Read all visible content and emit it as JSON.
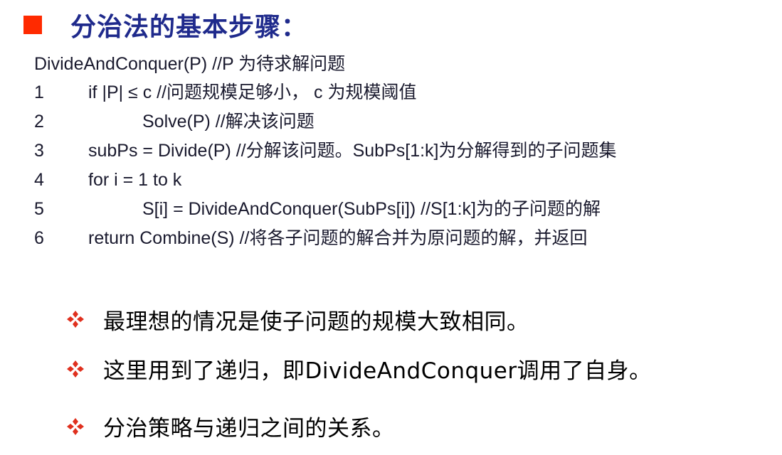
{
  "title": {
    "text": "分治法的基本步骤："
  },
  "code": {
    "header": "DivideAndConquer(P) //P 为待求解问题",
    "lines": [
      {
        "num": "1",
        "text": "if |P| ≤ c //问题规模足够小， c 为规模阈值"
      },
      {
        "num": "2",
        "text": "Solve(P) //解决该问题"
      },
      {
        "num": "3",
        "text": "subPs = Divide(P) //分解该问题。SubPs[1:k]为分解得到的子问题集"
      },
      {
        "num": "4",
        "text": "for i = 1 to k"
      },
      {
        "num": "5",
        "text": "S[i] = DivideAndConquer(SubPs[i]) //S[1:k]为的子问题的解"
      },
      {
        "num": "6",
        "text": "return Combine(S) //将各子问题的解合并为原问题的解，并返回"
      }
    ]
  },
  "bullets": [
    {
      "text": "最理想的情况是使子问题的规模大致相同。"
    },
    {
      "text": "这里用到了递归，即DivideAndConquer调用了自身。"
    },
    {
      "text": "分治策略与递归之间的关系。"
    }
  ],
  "colors": {
    "title": "#1f2a8c",
    "title_marker": "#ff2a00",
    "bullet_icon": "#e0301e",
    "code_text": "#1a1a2e"
  },
  "icons": {
    "title_marker": "red-square-icon",
    "bullet": "four-diamond-bullet-icon"
  }
}
